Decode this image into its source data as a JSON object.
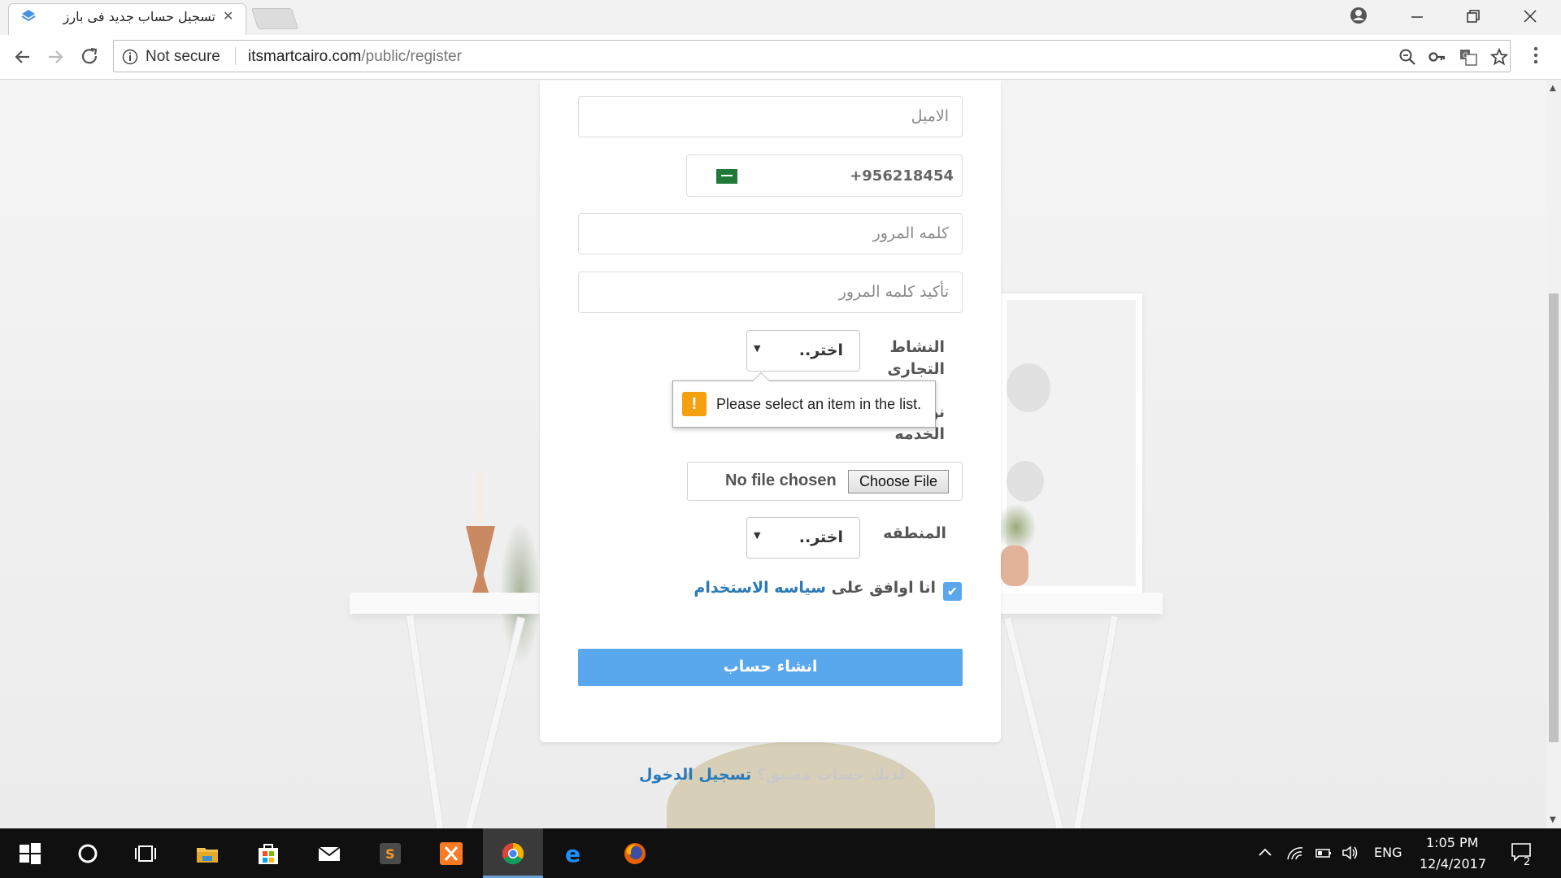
{
  "browser": {
    "tab_title": "تسجيل حساب جديد فى بارز",
    "security_label": "Not secure",
    "url_host": "itsmartcairo.com",
    "url_path": "/public/register"
  },
  "form": {
    "email_placeholder": "الاميل",
    "phone_value": "+956218454",
    "password_placeholder": "كلمه المرور",
    "confirm_password_placeholder": "تأكيد كلمه المرور",
    "business_label": "النشاط التجارى",
    "business_value": "اختر..",
    "service_label": "نوع الخدمه",
    "file_status": "No file chosen",
    "file_button": "Choose File",
    "region_label": "المنطقه",
    "region_value": "اختر..",
    "agree_text": "انا اوافق على",
    "agree_link": "سياسه الاستخدام",
    "submit_label": "انشاء حساب",
    "validation_message": "Please select an item in the list.",
    "login_question": "لديك حساب مسبق؟",
    "login_link": "تسجيل الدخول"
  },
  "taskbar": {
    "language": "ENG",
    "time": "1:05 PM",
    "date": "12/4/2017",
    "notification_count": "2"
  },
  "colors": {
    "accent": "#59a8ee",
    "link": "#2a7ab8",
    "warning": "#f5a00f"
  }
}
